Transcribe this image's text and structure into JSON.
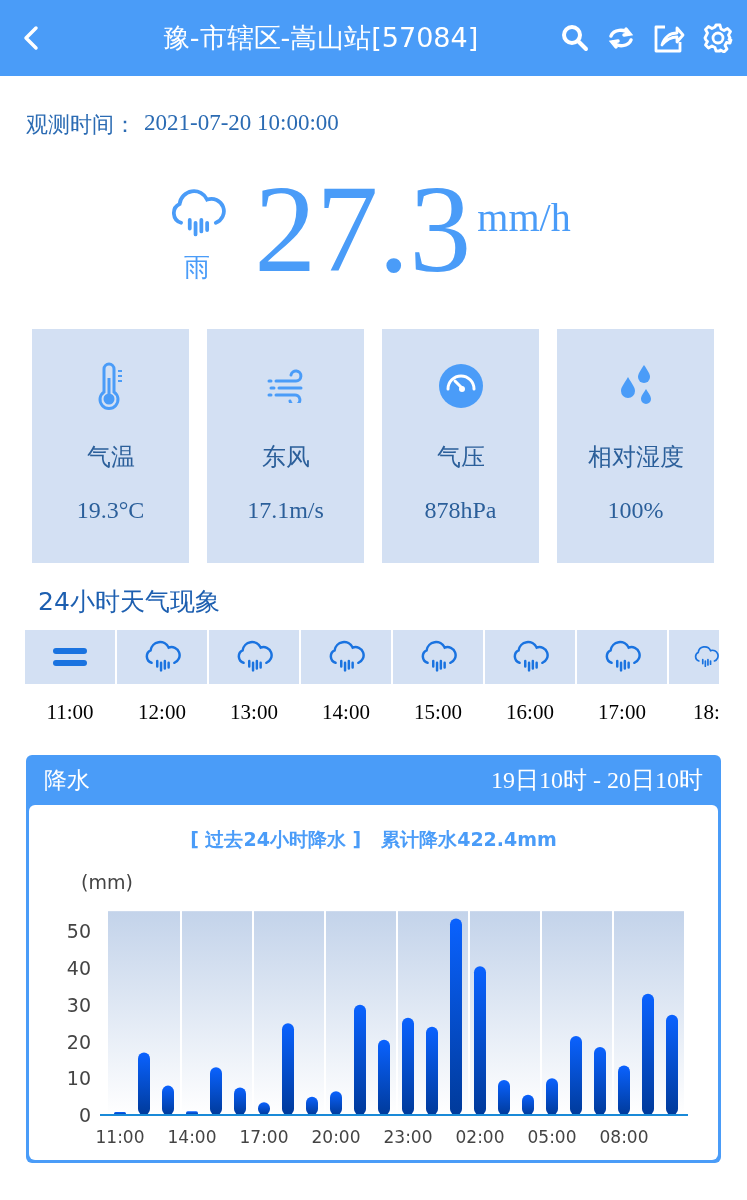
{
  "header": {
    "title": "豫-市辖区-嵩山站[57084]"
  },
  "observation": {
    "label": "观测时间：",
    "time": "2021-07-20 10:00:00"
  },
  "current": {
    "weather": "雨",
    "value": "27.3",
    "unit": "mm/h"
  },
  "stats": [
    {
      "kind": "temperature",
      "label": "气温",
      "value": "19.3°C"
    },
    {
      "kind": "wind",
      "label": "东风",
      "value": "17.1m/s"
    },
    {
      "kind": "pressure",
      "label": "气压",
      "value": "878hPa"
    },
    {
      "kind": "humidity",
      "label": "相对湿度",
      "value": "100%"
    }
  ],
  "forecast": {
    "title": "24小时天气现象",
    "hours": [
      {
        "kind": "haze",
        "time": "11:00"
      },
      {
        "kind": "rain",
        "time": "12:00"
      },
      {
        "kind": "rain",
        "time": "13:00"
      },
      {
        "kind": "rain",
        "time": "14:00"
      },
      {
        "kind": "rain",
        "time": "15:00"
      },
      {
        "kind": "rain",
        "time": "16:00"
      },
      {
        "kind": "rain",
        "time": "17:00"
      },
      {
        "kind": "rain",
        "time": "18:"
      }
    ]
  },
  "precipitation": {
    "title": "降水",
    "range": "19日10时 - 20日10时",
    "chart_title": "[ 过去24小时降水 ]",
    "total": "累计降水422.4mm",
    "chart_data": {
      "type": "bar",
      "ylabel": "(mm)",
      "categories": [
        "11:00",
        null,
        null,
        "14:00",
        null,
        null,
        "17:00",
        null,
        null,
        "20:00",
        null,
        null,
        "23:00",
        null,
        null,
        "02:00",
        null,
        null,
        "05:00",
        null,
        null,
        "08:00",
        null,
        null
      ],
      "values": [
        0.3,
        17,
        8,
        1,
        13,
        7.5,
        3.5,
        25,
        5,
        6.5,
        30,
        20.5,
        26.5,
        24,
        53.5,
        40.5,
        9.5,
        5.5,
        10,
        21.5,
        18.5,
        13.5,
        33,
        27.3
      ],
      "ylim": [
        0,
        55
      ],
      "yticks": [
        0,
        10,
        20,
        30,
        40,
        50
      ]
    }
  }
}
